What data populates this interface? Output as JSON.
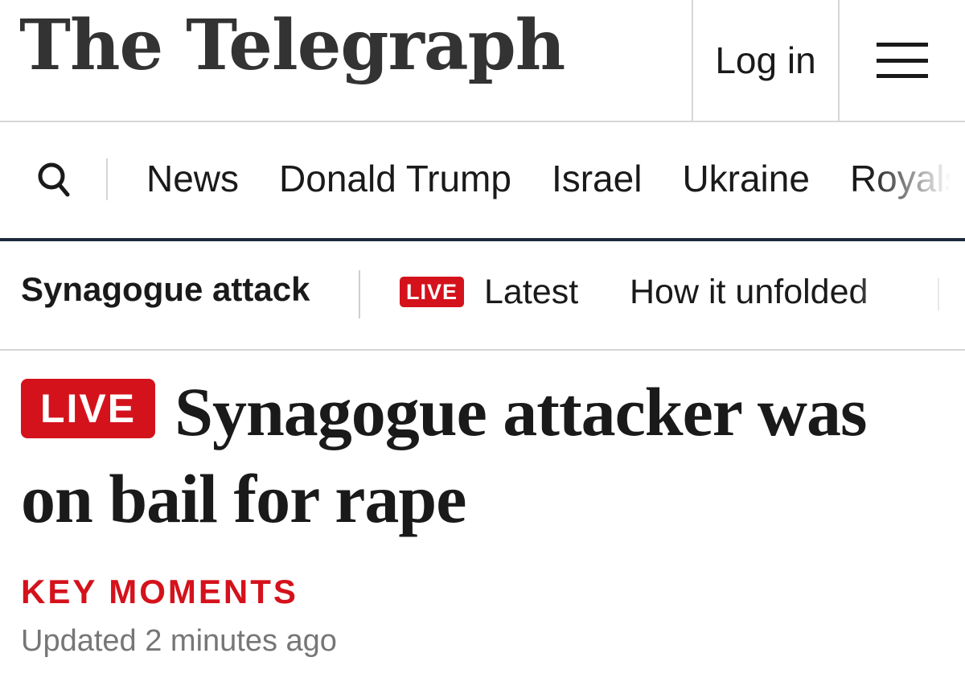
{
  "header": {
    "logo_text": "The Telegraph",
    "login_label": "Log in",
    "menu_icon": "hamburger-menu-icon"
  },
  "nav": {
    "search_icon": "search-icon",
    "items": [
      "News",
      "Donald Trump",
      "Israel",
      "Ukraine",
      "Royals"
    ]
  },
  "subnav": {
    "topic": "Synagogue attack",
    "live_badge": "LIVE",
    "latest": "Latest",
    "how_it_unfolded": "How it unfolded"
  },
  "article": {
    "live_badge": "LIVE",
    "headline": "Synagogue attacker was on bail for rape",
    "key_moments": "KEY MOMENTS",
    "updated": "Updated 2 minutes ago"
  },
  "colors": {
    "accent_red": "#d4121c",
    "nav_border": "#1c2a3a",
    "text": "#1a1a1a",
    "muted": "#767676"
  }
}
